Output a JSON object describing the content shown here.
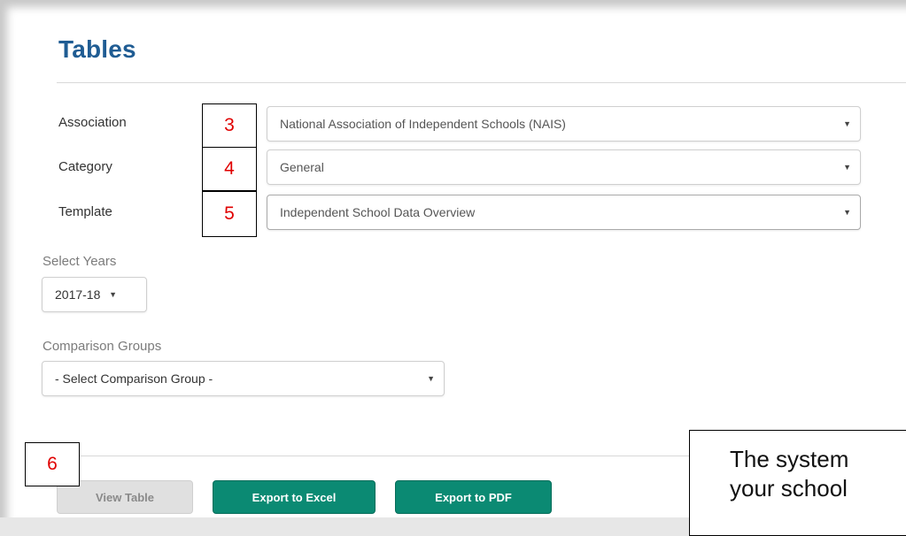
{
  "page": {
    "title": "Tables"
  },
  "form": {
    "association": {
      "label": "Association",
      "value": "National Association of Independent Schools (NAIS)"
    },
    "category": {
      "label": "Category",
      "value": "General"
    },
    "template": {
      "label": "Template",
      "value": "Independent School Data Overview"
    },
    "years": {
      "label": "Select Years",
      "value": "2017-18"
    },
    "comparison_groups": {
      "label": "Comparison Groups",
      "value": "- Select Comparison Group -"
    }
  },
  "annotations": {
    "step3": "3",
    "step4": "4",
    "step5": "5",
    "step6": "6",
    "callout_line1": "The system",
    "callout_line2": "your school"
  },
  "buttons": {
    "view_table": "View Table",
    "export_excel": "Export to Excel",
    "export_pdf": "Export to PDF"
  },
  "icons": {
    "dropdown_caret": "▼"
  },
  "colors": {
    "title": "#1f5c93",
    "primary_button": "#0b8a73",
    "annotation_number": "#e00000"
  }
}
